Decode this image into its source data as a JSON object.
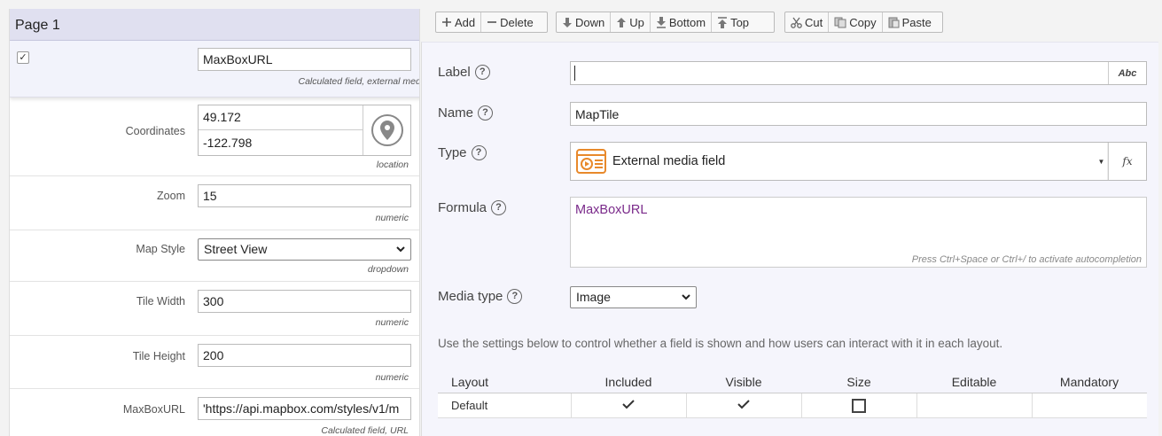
{
  "page": {
    "title": "Page 1"
  },
  "selected_field": {
    "value": "MaxBoxURL",
    "hint": "Calculated field, external media"
  },
  "fields": [
    {
      "label": "Coordinates",
      "lat": "49.172",
      "lng": "-122.798",
      "hint": "location"
    },
    {
      "label": "Zoom",
      "value": "15",
      "hint": "numeric"
    },
    {
      "label": "Map Style",
      "value": "Street View",
      "hint": "dropdown"
    },
    {
      "label": "Tile Width",
      "value": "300",
      "hint": "numeric"
    },
    {
      "label": "Tile Height",
      "value": "200",
      "hint": "numeric"
    },
    {
      "label": "MaxBoxURL",
      "value": "'https://api.mapbox.com/styles/v1/m",
      "hint": "Calculated field, URL"
    }
  ],
  "toolbar": {
    "add": "Add",
    "delete": "Delete",
    "down": "Down",
    "up": "Up",
    "bottom": "Bottom",
    "top": "Top",
    "cut": "Cut",
    "copy": "Copy",
    "paste": "Paste"
  },
  "props": {
    "label": {
      "caption": "Label",
      "value": "",
      "abc": "Abc"
    },
    "name": {
      "caption": "Name",
      "value": "MapTile"
    },
    "type": {
      "caption": "Type",
      "value": "External media field",
      "fx": "fx"
    },
    "formula": {
      "caption": "Formula",
      "value": "MaxBoxURL",
      "hint": "Press Ctrl+Space or Ctrl+/ to activate autocompletion",
      "color": "#7a2a8a"
    },
    "media_type": {
      "caption": "Media type",
      "value": "Image"
    }
  },
  "settings_text": "Use the settings below to control whether a field is shown and how users can interact with it in each layout.",
  "layout_table": {
    "headers": [
      "Layout",
      "Included",
      "Visible",
      "Size",
      "Editable",
      "Mandatory"
    ],
    "rows": [
      {
        "layout": "Default",
        "included": true,
        "visible": true,
        "size": "unchecked",
        "editable": "",
        "mandatory": ""
      }
    ]
  },
  "icons": {
    "checkbox": "check-icon",
    "pin": "location-pin-icon",
    "help": "help-icon",
    "media": "external-media-icon",
    "check": "check-mark-icon",
    "square": "empty-square-icon"
  }
}
